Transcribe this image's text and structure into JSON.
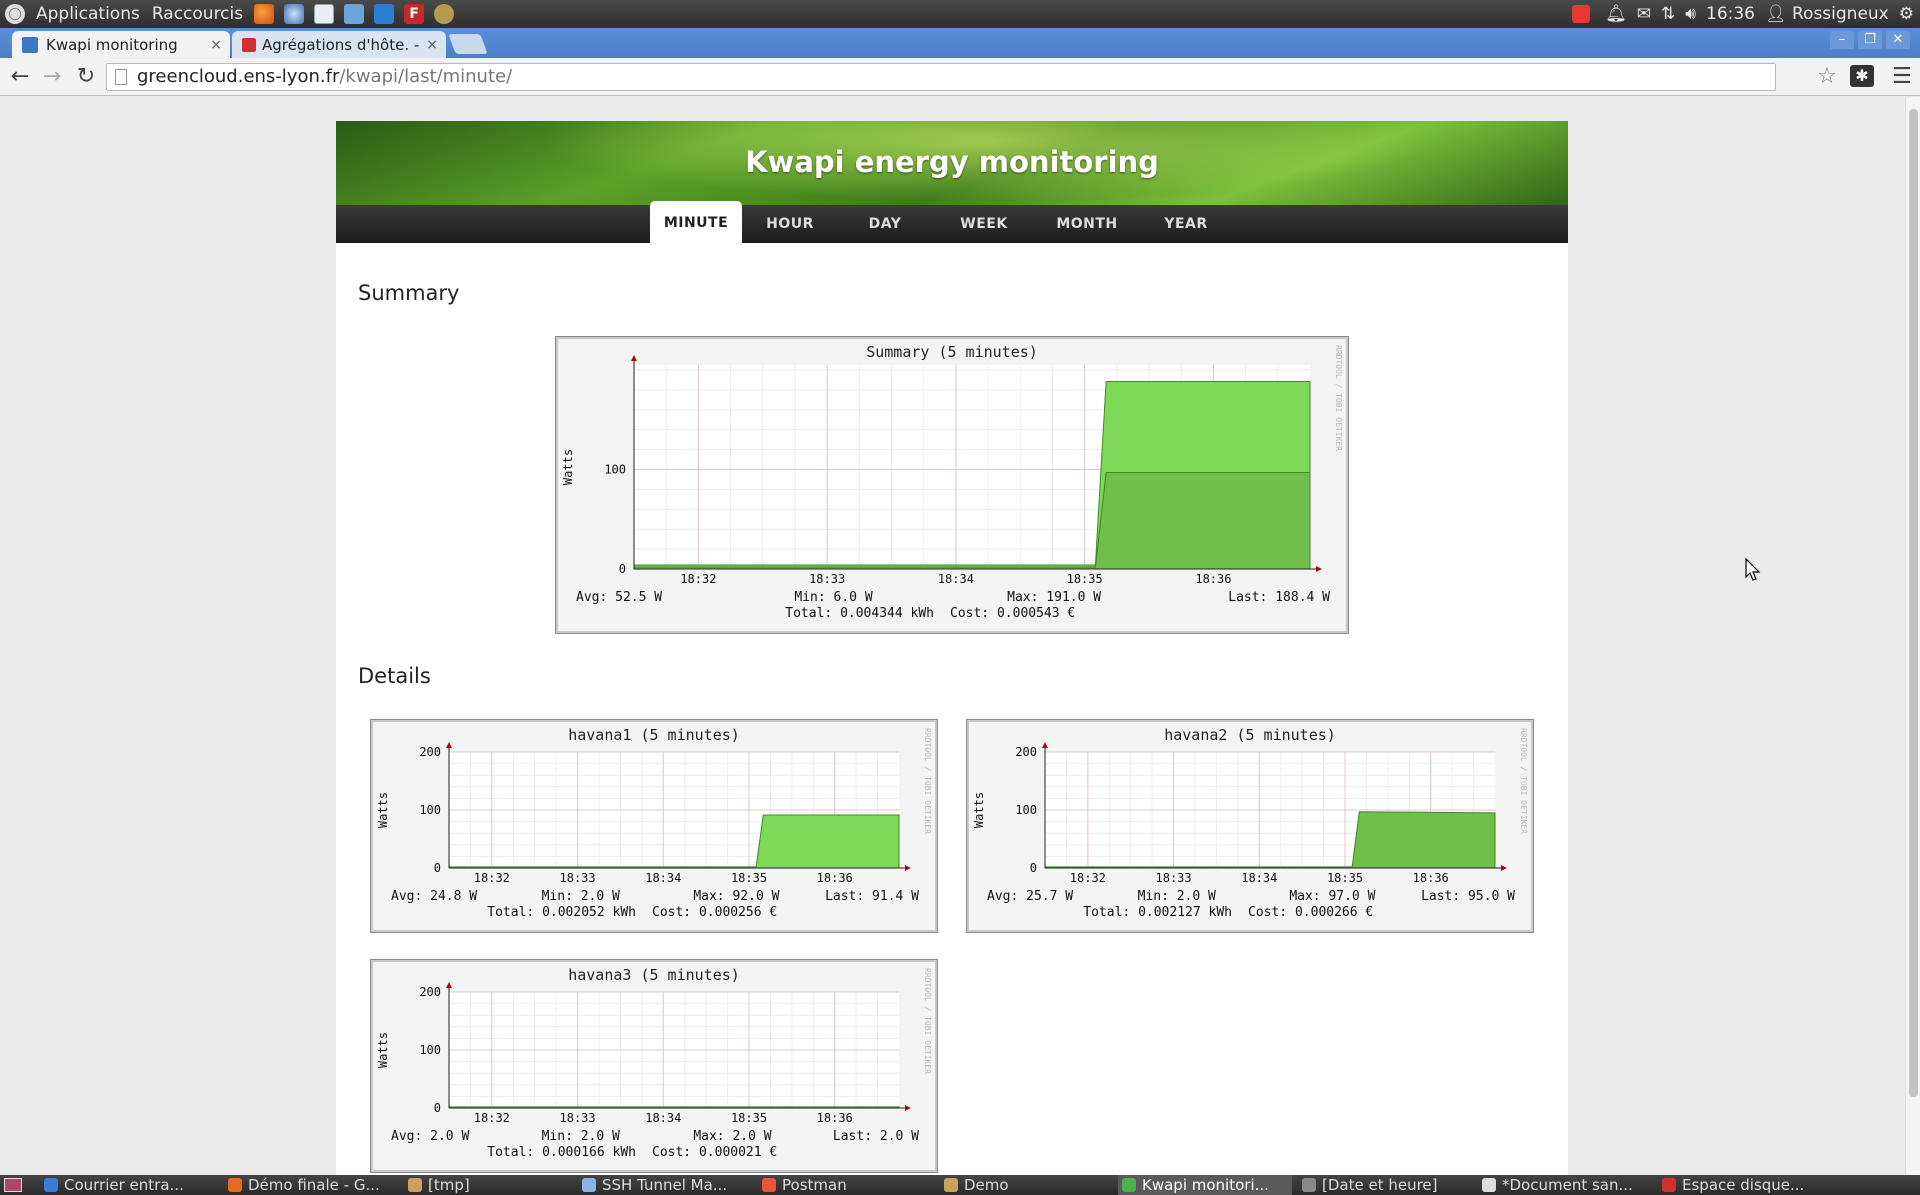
{
  "topbar": {
    "applications": "Applications",
    "shortcuts": "Raccourcis",
    "clock": "16:36",
    "user": "Rossigneux"
  },
  "tabs": [
    {
      "label": "Kwapi monitoring",
      "close": "×"
    },
    {
      "label": "Agrégations d'hôte. - ",
      "close": "×"
    }
  ],
  "address": {
    "host": "greencloud.ens-lyon.fr",
    "path": "/kwapi/last/minute/"
  },
  "site": {
    "title": "Kwapi energy monitoring",
    "menu": [
      "MINUTE",
      "HOUR",
      "DAY",
      "WEEK",
      "MONTH",
      "YEAR"
    ],
    "active_menu": "MINUTE",
    "summary_heading": "Summary",
    "details_heading": "Details"
  },
  "chart_data": [
    {
      "type": "area",
      "title": "Summary (5 minutes)",
      "ylabel": "Watts",
      "watermark": "RRDTOOL / TOBI OETIKER",
      "yticks": [
        "0",
        "100"
      ],
      "xticks": [
        "18:32",
        "18:33",
        "18:34",
        "18:35",
        "18:36"
      ],
      "ylim": [
        0,
        205
      ],
      "x": [
        "18:31:30",
        "18:35:05",
        "18:35:10",
        "18:36:45"
      ],
      "series": [
        {
          "values": [
            2.0,
            2.0,
            97.0,
            97.0
          ],
          "color": "#6fbf4a"
        },
        {
          "values": [
            2.0,
            2.0,
            91.4,
            91.4
          ],
          "color": "#7ed957"
        }
      ],
      "stats": {
        "avg": "Avg: 52.5 W",
        "min": "Min: 6.0 W",
        "max": "Max: 191.0 W",
        "last": "Last: 188.4 W",
        "total": "Total: 0.004344 kWh",
        "cost": "Cost: 0.000543 €"
      }
    },
    {
      "type": "area",
      "title": "havana1 (5 minutes)",
      "ylabel": "Watts",
      "watermark": "RRDTOOL / TOBI OETIKER",
      "yticks": [
        "0",
        "100",
        "200"
      ],
      "xticks": [
        "18:32",
        "18:33",
        "18:34",
        "18:35",
        "18:36"
      ],
      "ylim": [
        0,
        200
      ],
      "x": [
        "18:31:30",
        "18:35:05",
        "18:35:10",
        "18:36:45"
      ],
      "series": [
        {
          "values": [
            2.0,
            2.0,
            91.4,
            91.4
          ],
          "color": "#7ed957"
        }
      ],
      "stats": {
        "avg": "Avg: 24.8 W",
        "min": "Min: 2.0 W",
        "max": "Max: 92.0 W",
        "last": "Last: 91.4 W",
        "total": "Total: 0.002052 kWh",
        "cost": "Cost: 0.000256 €"
      }
    },
    {
      "type": "area",
      "title": "havana2 (5 minutes)",
      "ylabel": "Watts",
      "watermark": "RRDTOOL / TOBI OETIKER",
      "yticks": [
        "0",
        "100",
        "200"
      ],
      "xticks": [
        "18:32",
        "18:33",
        "18:34",
        "18:35",
        "18:36"
      ],
      "ylim": [
        0,
        200
      ],
      "x": [
        "18:31:30",
        "18:35:05",
        "18:35:10",
        "18:36:45"
      ],
      "series": [
        {
          "values": [
            2.0,
            2.0,
            97.0,
            95.0
          ],
          "color": "#6fbf4a"
        }
      ],
      "stats": {
        "avg": "Avg: 25.7 W",
        "min": "Min: 2.0 W",
        "max": "Max: 97.0 W",
        "last": "Last: 95.0 W",
        "total": "Total: 0.002127 kWh",
        "cost": "Cost: 0.000266 €"
      }
    },
    {
      "type": "area",
      "title": "havana3 (5 minutes)",
      "ylabel": "Watts",
      "watermark": "RRDTOOL / TOBI OETIKER",
      "yticks": [
        "0",
        "100",
        "200"
      ],
      "xticks": [
        "18:32",
        "18:33",
        "18:34",
        "18:35",
        "18:36"
      ],
      "ylim": [
        0,
        200
      ],
      "x": [
        "18:31:30",
        "18:36:45"
      ],
      "series": [
        {
          "values": [
            2.0,
            2.0
          ],
          "color": "#7ed957"
        }
      ],
      "stats": {
        "avg": "Avg: 2.0 W",
        "min": "Min: 2.0 W",
        "max": "Max: 2.0 W",
        "last": "Last: 2.0 W",
        "total": "Total: 0.000166 kWh",
        "cost": "Cost: 0.000021 €"
      }
    }
  ],
  "taskbar": [
    {
      "label": "Courrier entra...",
      "color": "#3a7bd5"
    },
    {
      "label": "Démo finale - G...",
      "color": "#e86a1f"
    },
    {
      "label": "[tmp]",
      "color": "#c9a15a"
    },
    {
      "label": "SSH Tunnel Ma...",
      "color": "#8ab4e6"
    },
    {
      "label": "Postman",
      "color": "#e8553a"
    },
    {
      "label": "Demo",
      "color": "#c9a15a"
    },
    {
      "label": "Kwapi monitori...",
      "color": "#4caf50"
    },
    {
      "label": "[Date et heure]",
      "color": "#888888"
    },
    {
      "label": "*Document san...",
      "color": "#dddddd"
    },
    {
      "label": "Espace disque...",
      "color": "#d32f2f"
    }
  ]
}
